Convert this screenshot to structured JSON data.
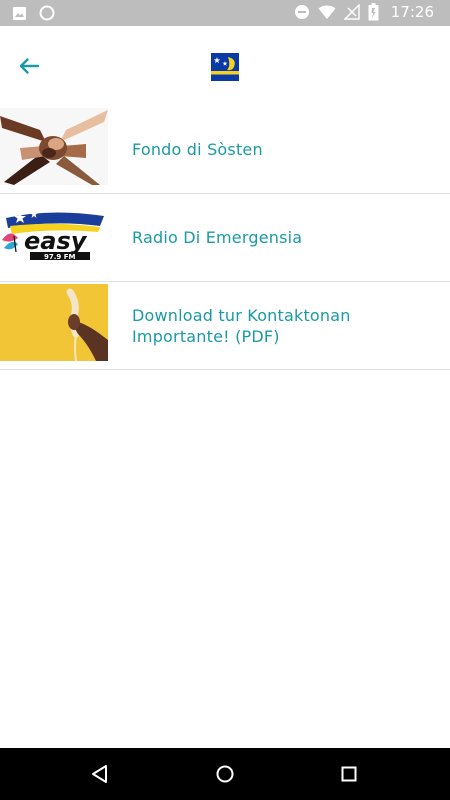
{
  "status_bar": {
    "time": "17:26",
    "icons": [
      "image-icon",
      "circle-icon",
      "do-not-disturb-icon",
      "wifi-icon",
      "no-signal-icon",
      "battery-icon"
    ]
  },
  "app_bar": {
    "back_icon": "arrow-left-icon",
    "logo": "curacao-flag-logo"
  },
  "colors": {
    "accent": "#1a9aa6",
    "status_bar_bg": "#bdbdbd",
    "nav_bar_bg": "#000000",
    "divider": "#e2e2e2",
    "flag_blue": "#0a3aa6",
    "flag_yellow": "#f4d21f",
    "phone_bg": "#f1c232"
  },
  "list": {
    "items": [
      {
        "label": "Fondo di Sòsten",
        "thumbnail": "joined-hands-image"
      },
      {
        "label": "Radio Di Emergensia",
        "thumbnail": "easy-97-9-fm-logo"
      },
      {
        "label": "Download tur Kontaktonan Importante! (PDF)",
        "thumbnail": "phone-handset-image"
      }
    ]
  },
  "nav_bar": {
    "buttons": [
      "back-triangle-icon",
      "home-circle-icon",
      "recents-square-icon"
    ]
  }
}
